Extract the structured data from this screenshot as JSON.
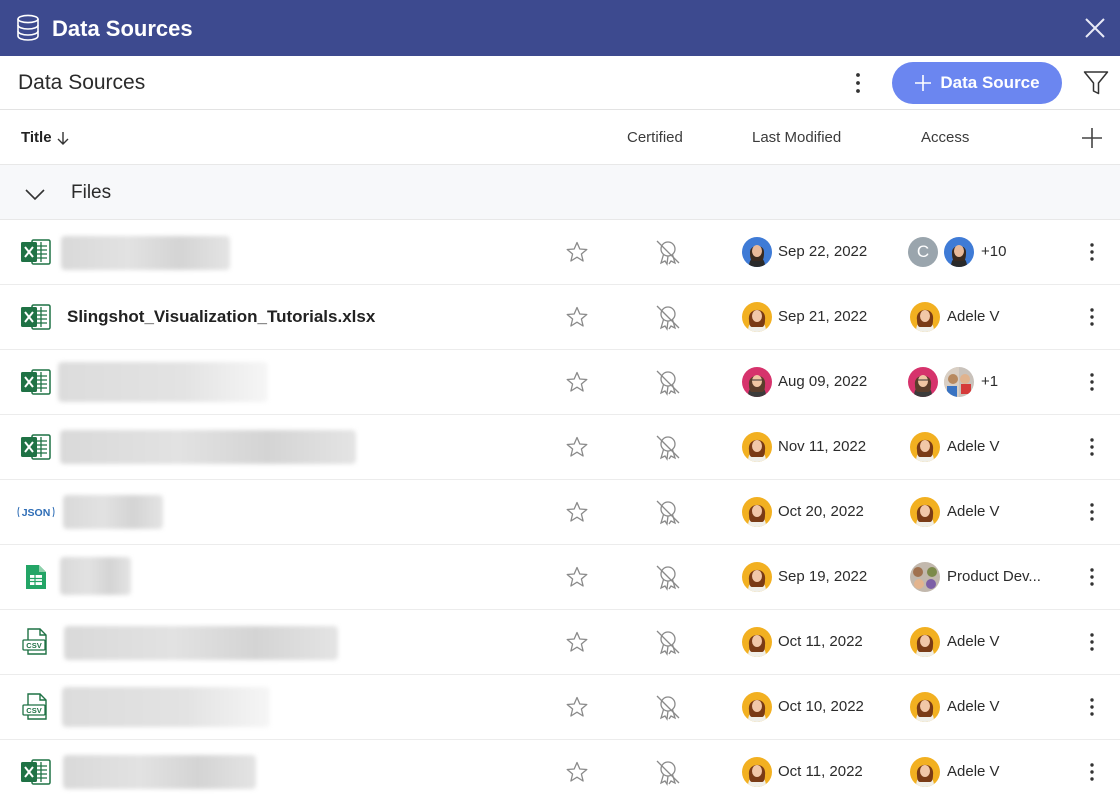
{
  "window": {
    "title": "Data Sources",
    "close_icon": "close-icon",
    "db_icon": "database-icon"
  },
  "toolbar": {
    "page_title": "Data Sources",
    "add_button_label": "Data Source",
    "accent": "#6b86f0"
  },
  "columns": {
    "title": "Title",
    "certified": "Certified",
    "last_modified": "Last Modified",
    "access": "Access"
  },
  "group": {
    "label": "Files"
  },
  "colors": {
    "titlebar": "#3d4a8f",
    "excel": "#1f7245",
    "sheets": "#23a566",
    "csv": "#1f7245",
    "json": "#2e6db6"
  },
  "rows": [
    {
      "type": "excel",
      "name": "",
      "blurred": true,
      "modified": "Sep 22, 2022",
      "mod_avatar": "avatar-blue",
      "access": [
        "avatar-c",
        "avatar-blue"
      ],
      "access_text": "+10",
      "access_initial": "C"
    },
    {
      "type": "excel",
      "name": "Slingshot_Visualization_Tutorials.xlsx",
      "blurred": false,
      "modified": "Sep 21, 2022",
      "mod_avatar": "avatar-adele",
      "access": [
        "avatar-adele"
      ],
      "access_text": "Adele V"
    },
    {
      "type": "excel",
      "name": "",
      "blurred": true,
      "modified": "Aug 09, 2022",
      "mod_avatar": "avatar-pink",
      "access": [
        "avatar-pink",
        "avatar-group"
      ],
      "access_text": "+1"
    },
    {
      "type": "excel",
      "name": "",
      "blurred": true,
      "modified": "Nov 11, 2022",
      "mod_avatar": "avatar-adele",
      "access": [
        "avatar-adele"
      ],
      "access_text": "Adele V"
    },
    {
      "type": "json",
      "name": "",
      "blurred": true,
      "modified": "Oct 20, 2022",
      "mod_avatar": "avatar-adele",
      "access": [
        "avatar-adele"
      ],
      "access_text": "Adele V",
      "json_label": "JSON"
    },
    {
      "type": "sheets",
      "name": "",
      "blurred": true,
      "modified": "Sep 19, 2022",
      "mod_avatar": "avatar-adele",
      "access": [
        "avatar-group"
      ],
      "access_text": "Product Dev..."
    },
    {
      "type": "csv",
      "name": "",
      "blurred": true,
      "modified": "Oct 11, 2022",
      "mod_avatar": "avatar-adele",
      "access": [
        "avatar-adele"
      ],
      "access_text": "Adele V",
      "csv_label": "CSV"
    },
    {
      "type": "csv",
      "name": "",
      "blurred": true,
      "modified": "Oct 10, 2022",
      "mod_avatar": "avatar-adele",
      "access": [
        "avatar-adele"
      ],
      "access_text": "Adele V",
      "csv_label": "CSV"
    },
    {
      "type": "excel",
      "name": "",
      "blurred": true,
      "modified": "Oct 11, 2022",
      "mod_avatar": "avatar-adele",
      "access": [
        "avatar-adele"
      ],
      "access_text": "Adele V"
    }
  ]
}
